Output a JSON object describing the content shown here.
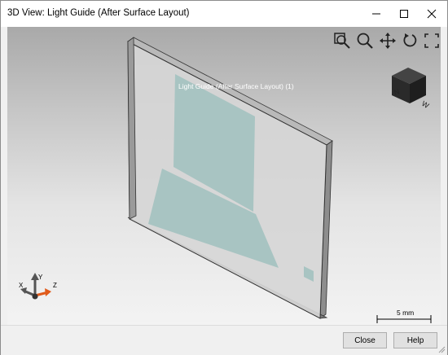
{
  "window": {
    "title": "3D View: Light Guide (After Surface Layout)"
  },
  "viewport": {
    "object_label": "Light Guide (After Surface Layout) (1)",
    "toolbar": [
      "zoom-window-icon",
      "zoom-icon",
      "pan-icon",
      "rotate-icon",
      "fit-all-icon"
    ],
    "axes": {
      "x": "X",
      "y": "Y",
      "z": "Z"
    },
    "scale_label": "5 mm"
  },
  "footer": {
    "close_label": "Close",
    "help_label": "Help"
  }
}
